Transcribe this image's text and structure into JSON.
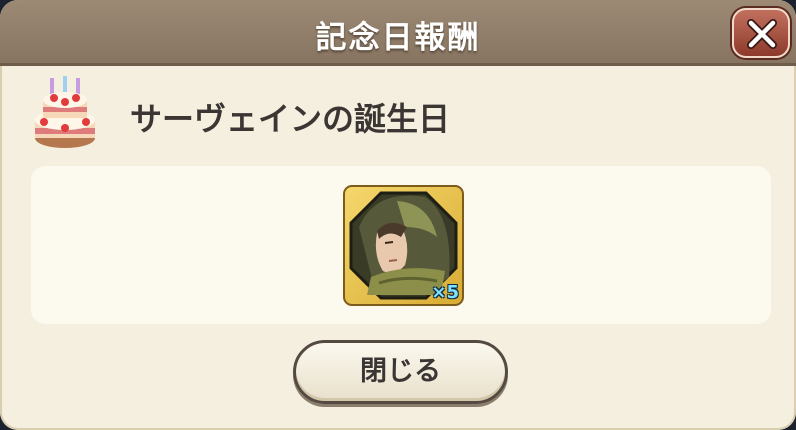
{
  "dialog": {
    "title": "記念日報酬",
    "event_title": "サーヴェインの誕生日",
    "close_button_label": "閉じる",
    "close_icon": "close-x-icon",
    "event_icon": "birthday-cake-icon"
  },
  "reward": {
    "item_icon": "hooded-character-portrait",
    "count": "×5"
  },
  "colors": {
    "titlebar": "#8f7d69",
    "close_button": "#a5503f",
    "panel_bg": "#f4efdf",
    "reward_frame": "#e8c14e",
    "count_text": "#7fe0ff"
  }
}
